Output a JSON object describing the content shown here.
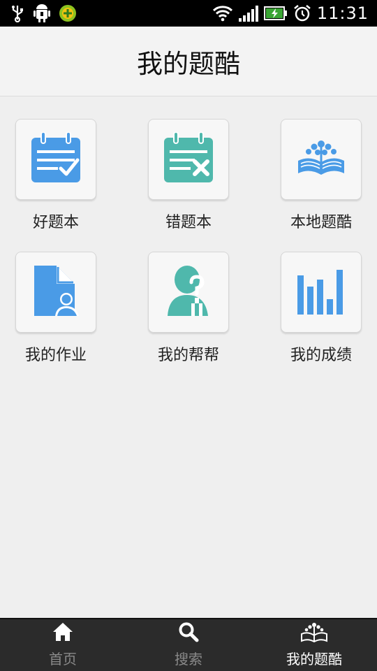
{
  "status_bar": {
    "time": "11:31",
    "icons": [
      "usb-icon",
      "android-debug-icon",
      "app-notification-icon",
      "wifi-icon",
      "signal-icon",
      "battery-charging-icon",
      "alarm-icon"
    ]
  },
  "header": {
    "title": "我的题酷"
  },
  "tiles": [
    {
      "label": "好题本",
      "icon": "good-questions-icon",
      "color": "#4a9be6"
    },
    {
      "label": "错题本",
      "icon": "wrong-questions-icon",
      "color": "#4fb8ac"
    },
    {
      "label": "本地题酷",
      "icon": "local-library-icon",
      "color": "#4a9be6"
    },
    {
      "label": "我的作业",
      "icon": "homework-icon",
      "color": "#4a9be6"
    },
    {
      "label": "我的帮帮",
      "icon": "help-icon",
      "color": "#4fb8ac"
    },
    {
      "label": "我的成绩",
      "icon": "scores-icon",
      "color": "#4a9be6"
    }
  ],
  "bottom_nav": {
    "items": [
      {
        "label": "首页",
        "icon": "home-icon",
        "active": false
      },
      {
        "label": "搜索",
        "icon": "search-icon",
        "active": false
      },
      {
        "label": "我的题酷",
        "icon": "my-library-icon",
        "active": true
      }
    ]
  }
}
